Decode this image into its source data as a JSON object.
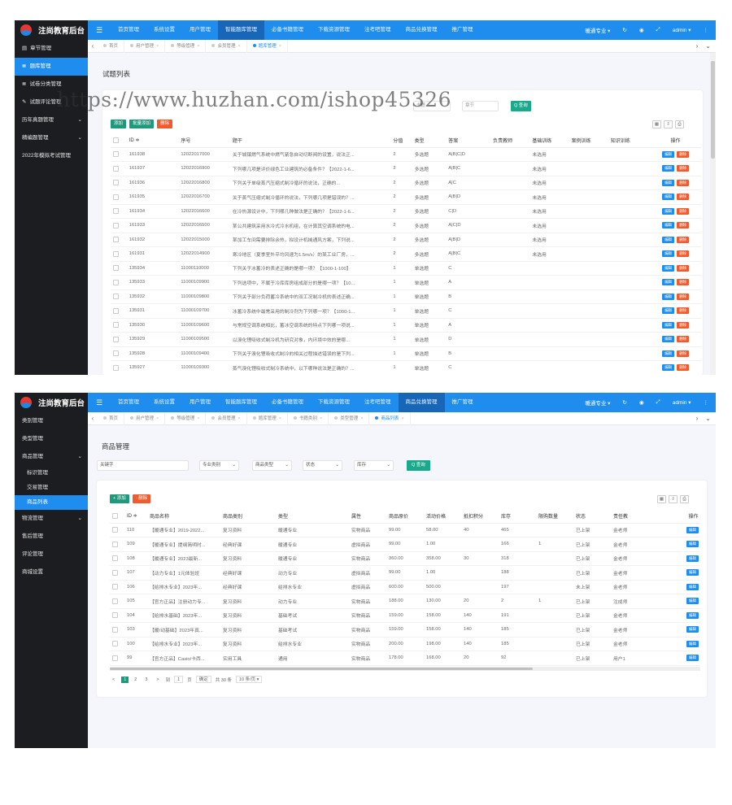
{
  "app_title": "注尚教育后台",
  "panel1": {
    "nav": [
      "首页管理",
      "系统设置",
      "用户管理",
      "智能题库管理",
      "必备书籍管理",
      "下载资源管理",
      "注考吧管理",
      "商品兑换管理",
      "推广管理"
    ],
    "nav_active": 3,
    "right_menu": {
      "profession": "暖通专业 ▾",
      "user": "admin ▾"
    },
    "sidebar": [
      {
        "label": "章节管理",
        "icon": "doc-icon"
      },
      {
        "label": "题库管理",
        "icon": "list-icon",
        "active": true
      },
      {
        "label": "试卷分类管理",
        "icon": "list-icon"
      },
      {
        "label": "试题评论管理",
        "icon": "comment-icon"
      },
      {
        "label": "历年真题管理",
        "chevron": true
      },
      {
        "label": "精编题管理",
        "chevron": true
      },
      {
        "label": "2022年模拟考试管理"
      }
    ],
    "tabs": [
      "首页",
      "用户管理",
      "等级管理",
      "会员管理",
      "题库管理"
    ],
    "active_tab": 4,
    "page_title": "试题列表",
    "filter_placeholders": {
      "keyword": "书籍",
      "chapter": "章节"
    },
    "search_label": "Q 查询",
    "buttons": {
      "add": "添加",
      "batch_add": "批量添加",
      "delete": "删除"
    },
    "columns": [
      "ID ≑",
      "序号",
      "题干",
      "分值",
      "类型",
      "答案",
      "负责教师",
      "基础训练",
      "案例训练",
      "知识训练",
      "操作"
    ],
    "rows": [
      [
        "161938",
        "12022017000",
        "关于城镇燃气系统中燃气紧急自动切断阀的设置，说法正...",
        "2",
        "多选题",
        "A|B|C|D",
        "",
        "未选用"
      ],
      [
        "161937",
        "12022016900",
        "下列哪几项是评价绿色工业建筑的必备条件？【2022-1-6...",
        "2",
        "多选题",
        "A|B|C",
        "",
        "未选用"
      ],
      [
        "161936",
        "12022016800",
        "下列关于单级蒸汽压缩式制冷循环的说法，正确的...",
        "2",
        "多选题",
        "A|C",
        "",
        "未选用"
      ],
      [
        "161935",
        "12022016700",
        "关于蒸气压缩式制冷循环的说法，下列哪几项是错误的？...",
        "2",
        "多选题",
        "A|B|D",
        "",
        "未选用"
      ],
      [
        "161934",
        "12022016600",
        "在冷热源设计中，下列哪几种做法是正确的？【2022-1-6...",
        "2",
        "多选题",
        "C|D",
        "",
        "未选用"
      ],
      [
        "161933",
        "12022016500",
        "某公共建筑采用水冷式冷水机组，在计算其空调系统的电...",
        "2",
        "多选题",
        "A|C|D",
        "",
        "未选用"
      ],
      [
        "161932",
        "12022015000",
        "某加工车间需要排除余热，拟设计机械通风方案，下列说...",
        "2",
        "多选题",
        "A|B|D",
        "",
        "未选用"
      ],
      [
        "161931",
        "12022014900",
        "寒冷地区（夏季室外平均风速为1.5m/s）的某工业厂房，...",
        "2",
        "多选题",
        "A|B|C",
        "",
        "未选用"
      ],
      [
        "135934",
        "11000110000",
        "下列关于冰蓄冷的表述正确的是哪一项？【1000-1-100】",
        "1",
        "单选题",
        "C",
        "",
        ""
      ],
      [
        "135933",
        "11000109900",
        "下列选项中，不属于冷库库房组成部分的是哪一项？【10...",
        "1",
        "单选题",
        "A",
        "",
        ""
      ],
      [
        "135932",
        "11000109800",
        "下列关于部分负荷蓄冷系统中的双工况制冷机的表述正确...",
        "1",
        "单选题",
        "B",
        "",
        ""
      ],
      [
        "135931",
        "11000109700",
        "冰蓄冷系统中最常采用的制冷剂为下列哪一项？【1000-1...",
        "1",
        "单选题",
        "C",
        "",
        ""
      ],
      [
        "135930",
        "11000109600",
        "与常规空调系统相比，蓄冰空调系统的特点下列哪一项说...",
        "1",
        "单选题",
        "A",
        "",
        ""
      ],
      [
        "135929",
        "11000109500",
        "以溴化锂吸收式制冷机为研究对象，内环境中效的是哪...",
        "1",
        "单选题",
        "D",
        "",
        ""
      ],
      [
        "135928",
        "11000109400",
        "下列关于溴化锂吸收式制冷的相关过程描述错误的是下列...",
        "1",
        "单选题",
        "B",
        "",
        ""
      ],
      [
        "135927",
        "11000109300",
        "蒸气溴化锂吸收式制冷系统中，以下哪种说法是正确的？...",
        "1",
        "单选题",
        "C",
        "",
        ""
      ]
    ],
    "row_actions": {
      "edit": "编辑",
      "delete": "删除"
    }
  },
  "panel2": {
    "nav": [
      "首页管理",
      "系统设置",
      "用户管理",
      "智能题库管理",
      "必备书籍管理",
      "下载资源管理",
      "注考吧管理",
      "商品兑换管理",
      "推广管理"
    ],
    "nav_active": 7,
    "right_menu": {
      "profession": "暖通专业 ▾",
      "user": "admin ▾"
    },
    "sidebar": [
      {
        "label": "类别管理"
      },
      {
        "label": "类型管理"
      },
      {
        "label": "商品管理",
        "chevron": true
      },
      {
        "label": "标识管理",
        "sub": true
      },
      {
        "label": "交易管理",
        "sub": true
      },
      {
        "label": "商品列表",
        "sub": true,
        "active": true
      },
      {
        "label": "物流管理",
        "chevron": true
      },
      {
        "label": "售后管理"
      },
      {
        "label": "评论管理"
      },
      {
        "label": "商城设置"
      }
    ],
    "tabs": [
      "首页",
      "用户管理",
      "等级管理",
      "会员管理",
      "题库管理",
      "书籍类别",
      "类型管理",
      "商品列表"
    ],
    "active_tab": 7,
    "page_title": "商品管理",
    "filters": {
      "keyword": "关键字",
      "major": "专业类别",
      "type": "商品类型",
      "status": "状态",
      "stock": "库存"
    },
    "search_label": "Q 查询",
    "buttons": {
      "add": "+ 添加",
      "delete": "- 删除"
    },
    "columns": [
      "ID ≑",
      "商品名称",
      "商品类别",
      "类型",
      "属性",
      "商品原价",
      "活动价格",
      "抵扣积分",
      "库存",
      "限购数量",
      "状态",
      "责任教",
      "操作"
    ],
    "rows": [
      [
        "110",
        "【暖通专业】2019-2022...",
        "复习资料",
        "暖通专业",
        "实物商品",
        "99.00",
        "58.00",
        "40",
        "465",
        "",
        "已上架",
        "金老师"
      ],
      [
        "109",
        "【暖通专业】提纲简明时...",
        "经典好课",
        "暖通专业",
        "虚拟商品",
        "99.00",
        "1.00",
        "",
        "166",
        "1",
        "已上架",
        "金老师"
      ],
      [
        "108",
        "【暖通专业】2023最新...",
        "复习资料",
        "暖通专业",
        "实物商品",
        "360.00",
        "358.00",
        "30",
        "318",
        "",
        "已上架",
        "金老师"
      ],
      [
        "107",
        "【动力专业】1元体验班",
        "经典好课",
        "动力专业",
        "虚拟商品",
        "99.00",
        "1.00",
        "",
        "188",
        "",
        "已上架",
        "金老师"
      ],
      [
        "106",
        "【给排水专业】2023年...",
        "经典好课",
        "给排水专业",
        "虚拟商品",
        "600.00",
        "500.00",
        "",
        "197",
        "",
        "未上架",
        "金老师"
      ],
      [
        "105",
        "【官方正品】注册动力专...",
        "复习资料",
        "动力专业",
        "实物商品",
        "188.00",
        "130.00",
        "20",
        "2",
        "1",
        "已上架",
        "注成师"
      ],
      [
        "104",
        "【给排水基础】2023年...",
        "复习资料",
        "基础考试",
        "实物商品",
        "159.00",
        "158.00",
        "140",
        "191",
        "",
        "已上架",
        "金老师"
      ],
      [
        "103",
        "【暖/动基础】2023年真...",
        "复习资料",
        "基础考试",
        "实物商品",
        "159.00",
        "158.00",
        "140",
        "185",
        "",
        "已上架",
        "金老师"
      ],
      [
        "100",
        "【给排水专业】2023年...",
        "复习资料",
        "给排水专业",
        "实物商品",
        "200.00",
        "198.00",
        "140",
        "185",
        "",
        "已上架",
        "金老师"
      ],
      [
        "99",
        "【官方正品】Casio/卡西...",
        "实用工具",
        "通用",
        "实物商品",
        "178.00",
        "168.00",
        "20",
        "92",
        "",
        "已上架",
        "用户1"
      ]
    ],
    "row_actions": {
      "edit": "编辑",
      "delete": "删除"
    },
    "pagination": {
      "prev": "<",
      "pages": [
        "1",
        "2",
        "3"
      ],
      "next": ">",
      "goto": "到",
      "goto_value": "1",
      "goto_unit": "页",
      "confirm": "确定",
      "total": "共 30 条",
      "page_size": "10 条/页 ▾"
    }
  },
  "watermark": "https://www.huzhan.com/ishop45326",
  "colors": {
    "primary": "#1f8ded",
    "sidebar": "#1c1d21",
    "green": "#1c9a7b",
    "red": "#f05a2c"
  }
}
